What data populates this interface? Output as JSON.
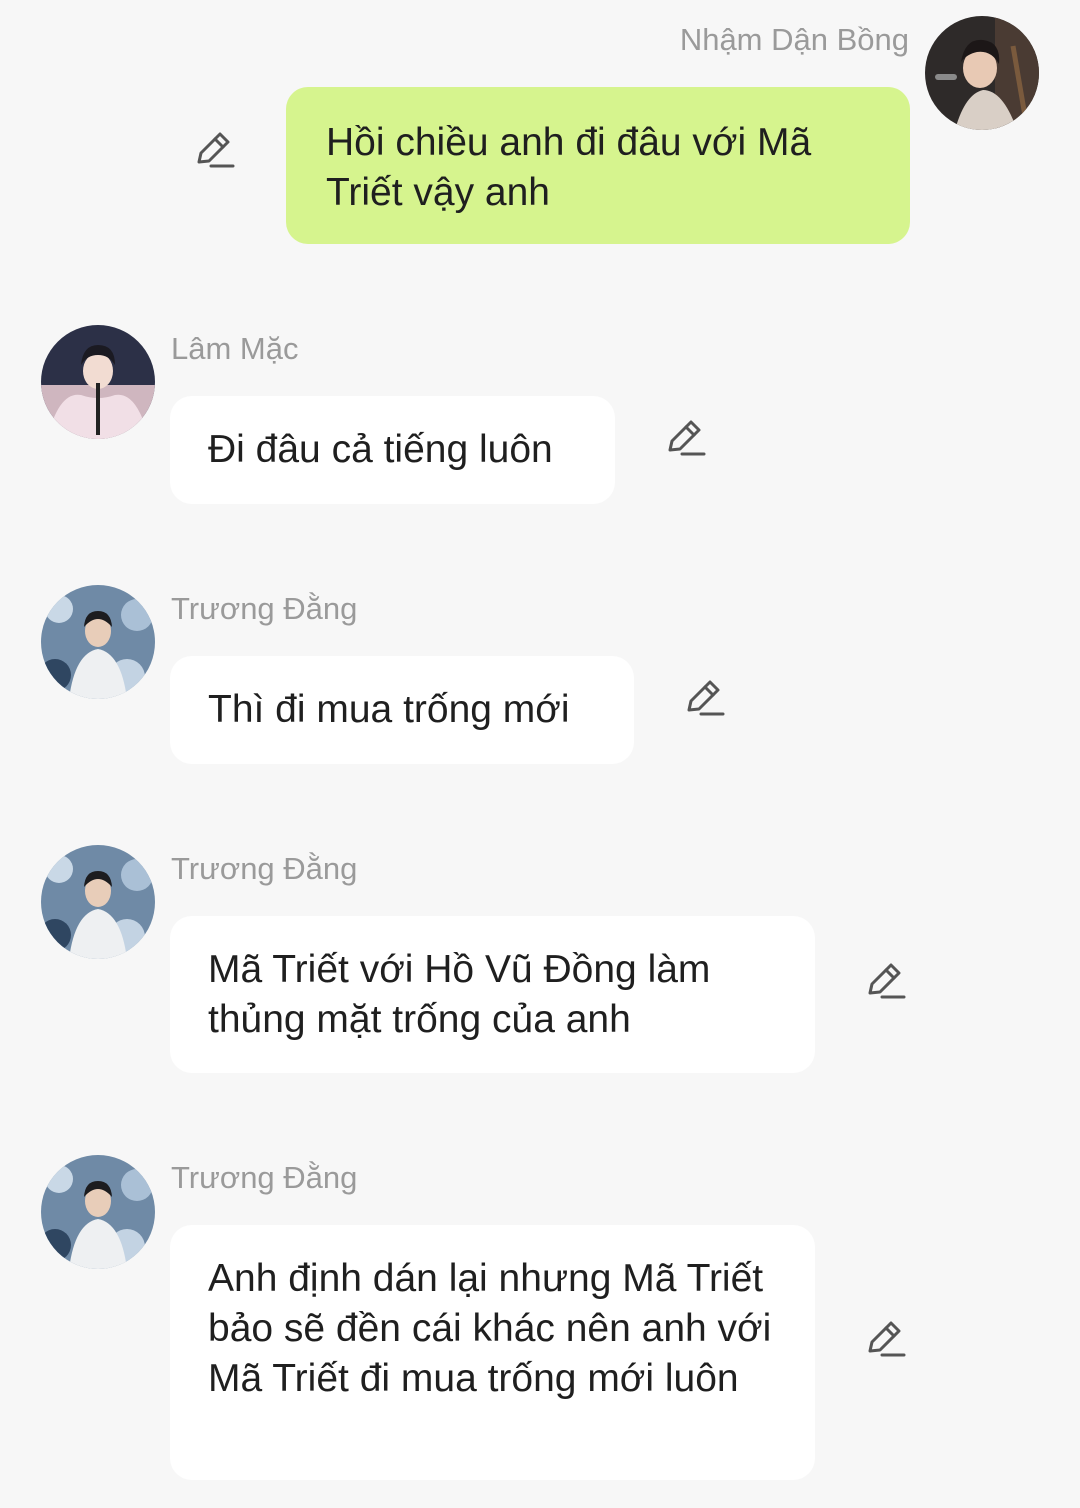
{
  "messages": [
    {
      "sender": "Nhậm Dận Bồng",
      "text": "Hồi chiều anh đi đâu với Mã Triết vậy anh",
      "outgoing": true
    },
    {
      "sender": "Lâm Mặc",
      "text": "Đi đâu cả tiếng luôn",
      "outgoing": false
    },
    {
      "sender": "Trương Đằng",
      "text": "Thì đi mua trống mới",
      "outgoing": false
    },
    {
      "sender": "Trương Đằng",
      "text": "Mã Triết với Hồ Vũ Đồng làm thủng mặt trống của anh",
      "outgoing": false
    },
    {
      "sender": "Trương Đằng",
      "text": "Anh định dán lại nhưng Mã Triết bảo sẽ đền cái khác nên anh với Mã Triết đi mua trống mới luôn",
      "outgoing": false
    }
  ],
  "colors": {
    "background": "#f7f7f7",
    "outgoing_bubble": "#d6f48e",
    "incoming_bubble": "#ffffff",
    "sender_name": "#9a9a9a"
  },
  "icons": {
    "edit": "pencil-edit-icon"
  }
}
